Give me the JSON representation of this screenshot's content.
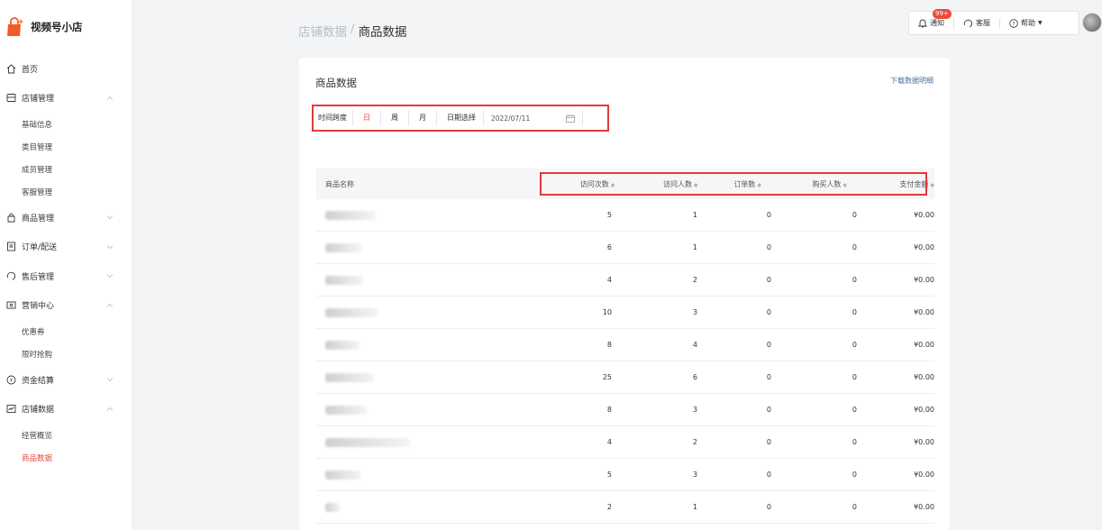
{
  "app": {
    "name": "视频号小店"
  },
  "sidebar": {
    "items": [
      {
        "label": "首页",
        "icon": "home-icon",
        "chevron": ""
      },
      {
        "label": "店铺管理",
        "icon": "store-icon",
        "chevron": "up",
        "children": [
          "基础信息",
          "类目管理",
          "成员管理",
          "客服管理"
        ]
      },
      {
        "label": "商品管理",
        "icon": "bag-icon",
        "chevron": "down"
      },
      {
        "label": "订单/配送",
        "icon": "order-icon",
        "chevron": "down"
      },
      {
        "label": "售后管理",
        "icon": "headset-icon",
        "chevron": "down"
      },
      {
        "label": "营销中心",
        "icon": "coupon-icon",
        "chevron": "up",
        "children": [
          "优惠券",
          "限时抢购"
        ]
      },
      {
        "label": "资金结算",
        "icon": "yen-icon",
        "chevron": "down"
      },
      {
        "label": "店铺数据",
        "icon": "chart-icon",
        "chevron": "up",
        "children": [
          "经营概览",
          "商品数据"
        ],
        "active_child": "商品数据"
      }
    ]
  },
  "breadcrumb": {
    "parent": "店铺数据",
    "separator": "/",
    "current": "商品数据"
  },
  "topbar": {
    "notice_label": "通知",
    "notice_badge": "99+",
    "service_label": "客服",
    "help_label": "帮助"
  },
  "card": {
    "title": "商品数据",
    "download_label": "下载数据明细",
    "filter": {
      "granularity_label": "时间跨度",
      "options": [
        "日",
        "周",
        "月"
      ],
      "selected": "日",
      "date_label": "日期选择",
      "date_value": "2022/07/11"
    },
    "table": {
      "columns": [
        "商品名称",
        "访问次数",
        "访问人数",
        "订单数",
        "购买人数",
        "支付金额"
      ],
      "rows": [
        {
          "visits": "5",
          "visitors": "1",
          "orders": "0",
          "buyers": "0",
          "amount": "¥0.00"
        },
        {
          "visits": "6",
          "visitors": "1",
          "orders": "0",
          "buyers": "0",
          "amount": "¥0.00"
        },
        {
          "visits": "4",
          "visitors": "2",
          "orders": "0",
          "buyers": "0",
          "amount": "¥0.00"
        },
        {
          "visits": "10",
          "visitors": "3",
          "orders": "0",
          "buyers": "0",
          "amount": "¥0.00"
        },
        {
          "visits": "8",
          "visitors": "4",
          "orders": "0",
          "buyers": "0",
          "amount": "¥0.00"
        },
        {
          "visits": "25",
          "visitors": "6",
          "orders": "0",
          "buyers": "0",
          "amount": "¥0.00"
        },
        {
          "visits": "8",
          "visitors": "3",
          "orders": "0",
          "buyers": "0",
          "amount": "¥0.00"
        },
        {
          "visits": "4",
          "visitors": "2",
          "orders": "0",
          "buyers": "0",
          "amount": "¥0.00"
        },
        {
          "visits": "5",
          "visitors": "3",
          "orders": "0",
          "buyers": "0",
          "amount": "¥0.00"
        },
        {
          "visits": "2",
          "visitors": "1",
          "orders": "0",
          "buyers": "0",
          "amount": "¥0.00"
        }
      ]
    }
  },
  "colors": {
    "accent": "#e5463a",
    "highlight_border": "#e13a3a"
  }
}
